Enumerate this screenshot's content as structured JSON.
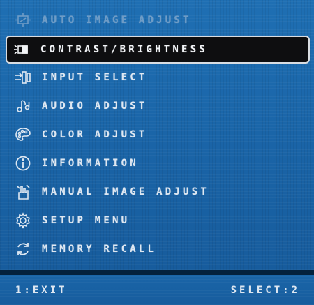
{
  "menu": {
    "items": [
      {
        "label": "AUTO IMAGE ADJUST",
        "icon": "auto-adjust-icon",
        "state": "disabled"
      },
      {
        "label": "CONTRAST/BRIGHTNESS",
        "icon": "brightness-icon",
        "state": "selected"
      },
      {
        "label": "INPUT SELECT",
        "icon": "input-select-icon",
        "state": "normal"
      },
      {
        "label": "AUDIO ADJUST",
        "icon": "audio-icon",
        "state": "normal"
      },
      {
        "label": "COLOR ADJUST",
        "icon": "color-palette-icon",
        "state": "normal"
      },
      {
        "label": "INFORMATION",
        "icon": "info-icon",
        "state": "normal"
      },
      {
        "label": "MANUAL IMAGE ADJUST",
        "icon": "manual-adjust-icon",
        "state": "normal"
      },
      {
        "label": "SETUP MENU",
        "icon": "gear-icon",
        "state": "normal"
      },
      {
        "label": "MEMORY RECALL",
        "icon": "recall-icon",
        "state": "normal"
      }
    ]
  },
  "footer": {
    "exit_label": "1:EXIT",
    "select_label": "SELECT:2"
  },
  "colors": {
    "panel": "#1a65a8",
    "background": "#04213d",
    "text": "#dfe8f2",
    "disabled_text": "#6f9cc6",
    "selected_bg": "#0e0e10"
  }
}
